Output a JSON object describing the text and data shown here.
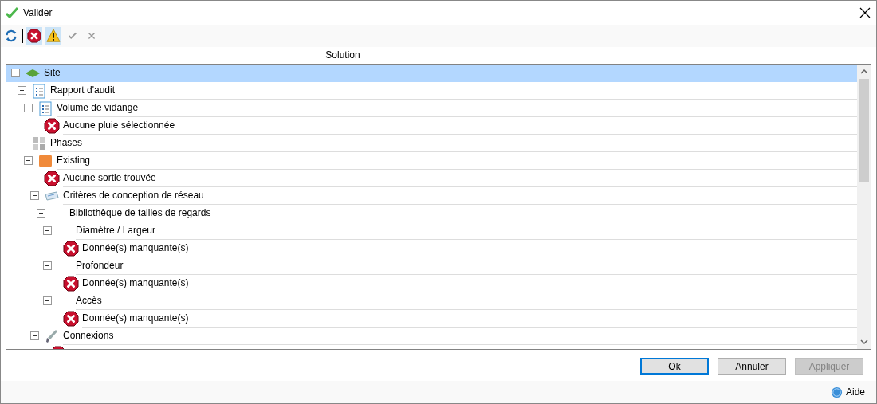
{
  "window": {
    "title": "Valider"
  },
  "toolbar": [
    {
      "kind": "refresh",
      "on": false
    },
    {
      "kind": "separator"
    },
    {
      "kind": "error",
      "on": true
    },
    {
      "kind": "warning",
      "on": true
    },
    {
      "kind": "check",
      "disabled": true
    },
    {
      "kind": "cross",
      "disabled": true
    }
  ],
  "tree": {
    "column": "Solution",
    "items": [
      {
        "kind": "site",
        "label": "Site",
        "selected": true,
        "expanded": true,
        "children": [
          {
            "kind": "report",
            "label": "Rapport d'audit",
            "selected": false,
            "expanded": true,
            "children": [
              {
                "kind": "report",
                "label": "Volume de vidange",
                "selected": false,
                "expanded": true,
                "children": [
                  {
                    "kind": "error",
                    "label": "Aucune pluie sélectionnée",
                    "selected": false
                  }
                ]
              }
            ]
          },
          {
            "kind": "phases",
            "label": "Phases",
            "selected": false,
            "expanded": true,
            "children": [
              {
                "kind": "phase",
                "label": "Existing",
                "selected": false,
                "expanded": true,
                "children": [
                  {
                    "kind": "error",
                    "label": "Aucune sortie trouvée",
                    "selected": false
                  },
                  {
                    "kind": "criteria",
                    "label": "Critères de conception de réseau",
                    "selected": false,
                    "expanded": true,
                    "children": [
                      {
                        "kind": "plain",
                        "label": "Bibliothèque de tailles de regards",
                        "selected": false,
                        "expanded": true,
                        "children": [
                          {
                            "kind": "plain",
                            "label": "Diamètre / Largeur",
                            "selected": false,
                            "expanded": true,
                            "children": [
                              {
                                "kind": "error",
                                "label": "Donnée(s) manquante(s)",
                                "selected": false
                              }
                            ]
                          },
                          {
                            "kind": "plain",
                            "label": "Profondeur",
                            "selected": false,
                            "expanded": true,
                            "children": [
                              {
                                "kind": "error",
                                "label": "Donnée(s) manquante(s)",
                                "selected": false
                              }
                            ]
                          },
                          {
                            "kind": "plain",
                            "label": "Accès",
                            "selected": false,
                            "expanded": true,
                            "children": [
                              {
                                "kind": "error",
                                "label": "Donnée(s) manquante(s)",
                                "selected": false
                              }
                            ]
                          }
                        ]
                      }
                    ]
                  },
                  {
                    "kind": "connection",
                    "label": "Connexions",
                    "selected": false,
                    "expanded": true,
                    "children": [
                      {
                        "kind": "error",
                        "selected": false
                      }
                    ]
                  }
                ]
              }
            ]
          }
        ]
      }
    ]
  },
  "buttons": [
    {
      "label": "Ok",
      "default": true,
      "disabled": false
    },
    {
      "label": "Annuler",
      "default": false,
      "disabled": false
    },
    {
      "label": "Appliquer",
      "default": false,
      "disabled": true
    }
  ],
  "help": {
    "label": "Aide"
  }
}
